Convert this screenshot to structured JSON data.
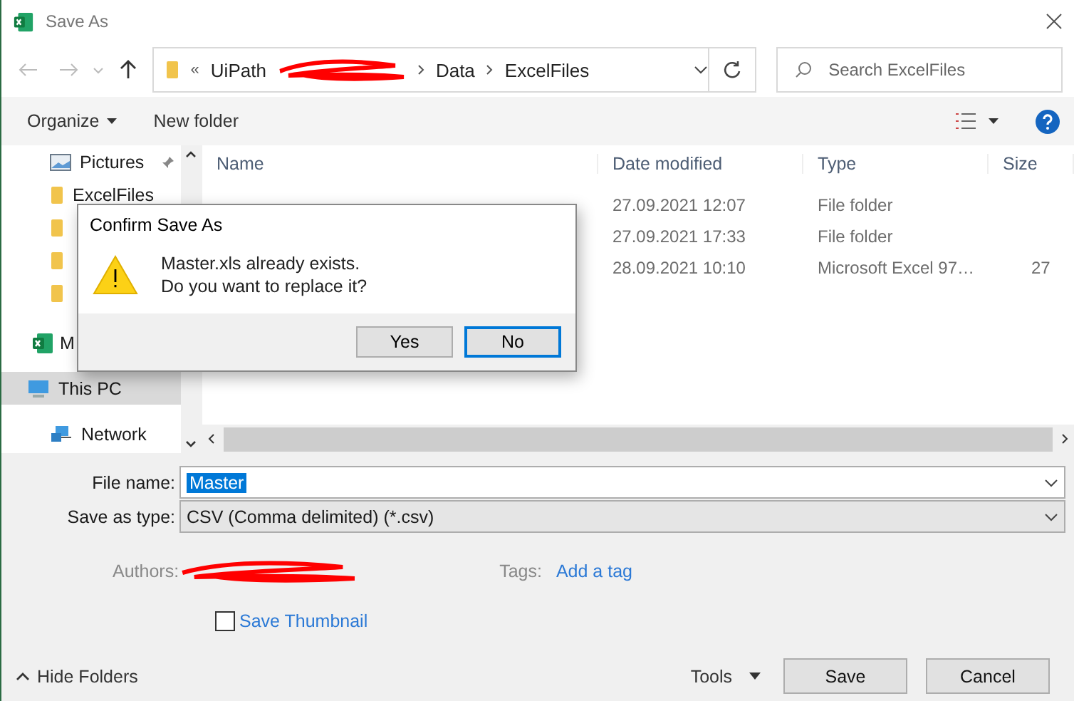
{
  "window": {
    "title": "Save As"
  },
  "address_bar": {
    "overflow": "«",
    "segments": [
      "UiPath",
      "Data",
      "ExcelFiles"
    ]
  },
  "search": {
    "placeholder": "Search ExcelFiles"
  },
  "toolbar": {
    "organize": "Organize",
    "new_folder": "New folder"
  },
  "sidebar": {
    "items": [
      {
        "kind": "pictures",
        "label": "Pictures",
        "selected": false
      },
      {
        "kind": "folder",
        "label": "ExcelFiles",
        "selected": false
      },
      {
        "kind": "folder",
        "selected": false
      },
      {
        "kind": "folder",
        "selected": false
      },
      {
        "kind": "folder",
        "selected": false
      },
      {
        "kind": "excel",
        "label": "M",
        "selected": false
      },
      {
        "kind": "pc",
        "label": "This PC",
        "selected": true
      },
      {
        "kind": "network",
        "label": "Network",
        "selected": false
      }
    ]
  },
  "columns": [
    "Name",
    "Date modified",
    "Type",
    "Size"
  ],
  "rows": [
    {
      "date": "27.09.2021 12:07",
      "type": "File folder"
    },
    {
      "date": "27.09.2021 17:33",
      "type": "File folder"
    },
    {
      "date": "28.09.2021 10:10",
      "type": "Microsoft Excel 97…",
      "size": "27"
    }
  ],
  "file_name": {
    "label": "File name:",
    "value": "Master"
  },
  "save_type": {
    "label": "Save as type:",
    "value": "CSV (Comma delimited) (*.csv)"
  },
  "authors": {
    "label": "Authors:"
  },
  "tags": {
    "label": "Tags:",
    "value": "Add a tag"
  },
  "save_thumbnail": {
    "label": "Save Thumbnail",
    "checked": false
  },
  "hide_folders": "Hide Folders",
  "tools": "Tools",
  "buttons": [
    "Save",
    "Cancel"
  ],
  "dialog": {
    "title": "Confirm Save As",
    "message": [
      "Master.xls already exists.",
      "Do you want to replace it?"
    ],
    "buttons": [
      {
        "label": "Yes",
        "selected": false
      },
      {
        "label": "No",
        "selected": true
      }
    ]
  }
}
